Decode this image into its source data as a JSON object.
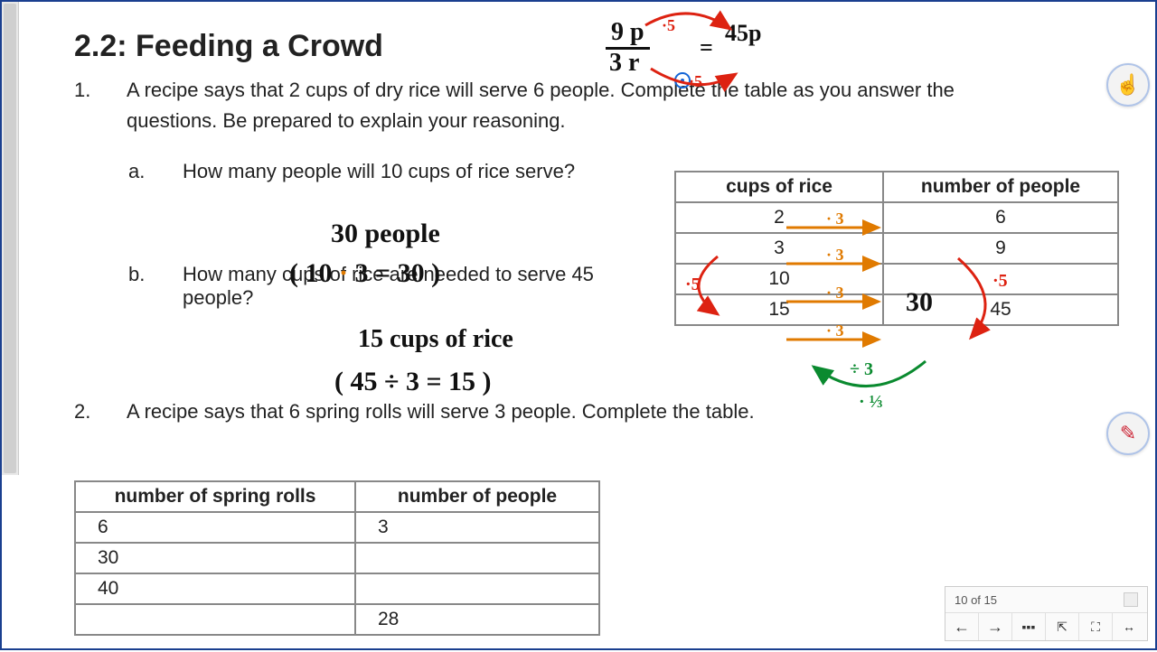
{
  "title": "2.2: Feeding a Crowd",
  "q1": {
    "num": "1.",
    "text": "A recipe says that 2 cups of dry rice will serve 6 people. Complete the table as you answer the questions. Be prepared to explain your reasoning.",
    "a": {
      "letter": "a.",
      "text": "How many people will 10 cups of rice serve?"
    },
    "b": {
      "letter": "b.",
      "text": "How many cups of rice are needed to serve 45 people?"
    }
  },
  "q2": {
    "num": "2.",
    "text": "A recipe says that 6 spring rolls will serve 3 people. Complete the table."
  },
  "rice_table": {
    "h1": "cups of rice",
    "h2": "number of people",
    "rows": [
      {
        "c": "2",
        "p": "6"
      },
      {
        "c": "3",
        "p": "9"
      },
      {
        "c": "10",
        "p": "30"
      },
      {
        "c": "15",
        "p": "45"
      }
    ]
  },
  "rolls_table": {
    "h1": "number of spring rolls",
    "h2": "number of people",
    "rows": [
      {
        "s": "6",
        "p": "3"
      },
      {
        "s": "30",
        "p": ""
      },
      {
        "s": "40",
        "p": ""
      },
      {
        "s": "",
        "p": "28"
      }
    ]
  },
  "handwriting": {
    "topfrac_num": "9 p",
    "topfrac_den": "3 r",
    "topfrac_eq": "=",
    "topfrac_rhs": "45p",
    "topfrac_mult_top": "·5",
    "topfrac_mult_bot": "·5",
    "ans_a1": "30 people",
    "ans_a2_open": "( 10",
    "ans_a2_dot": " · ",
    "ans_a2_rest": "3 = 30 )",
    "ans_b1": "15 cups of rice",
    "ans_b2": "( 45 ÷ 3 = 15 )",
    "row30": "30",
    "o_mult": "· 3",
    "left_red": "·5",
    "right_red": "·5",
    "g_div": "÷ 3",
    "g_frac": "· ⅓"
  },
  "nav": {
    "page": "10 of 15"
  },
  "icons": {
    "hand": "☝",
    "pen": "✎",
    "prev": "←",
    "next": "→",
    "menu": "▪▪▪",
    "fit_page": "⇱",
    "fit_width": "⛶",
    "two_way": "↔"
  }
}
